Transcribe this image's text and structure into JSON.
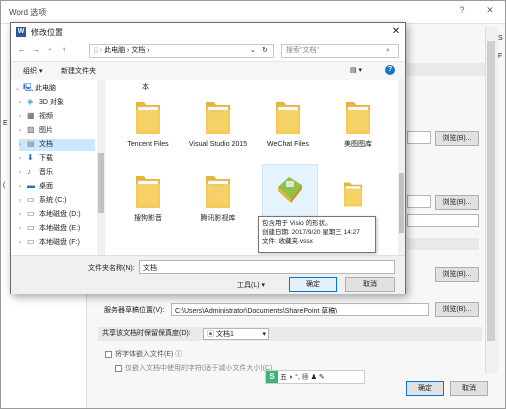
{
  "options_window": {
    "title": "Word 选项",
    "help": "?",
    "close": "✕",
    "browse_label": "浏览(B)...",
    "sp_label": "服务器草稿位置(V):",
    "sp_path": "C:\\Users\\Administrator\\Documents\\SharePoint 草稿\\",
    "fidelity_label": "共享该文档时保留保真度(D):",
    "fidelity_doc": "文档1",
    "embed_fonts": "将字体嵌入文件(E)",
    "embed_only_used": "仅嵌入文档中使用的字符(适于减小文件大小)(C)",
    "ok": "确定",
    "cancel": "取消",
    "side_letters": [
      "E",
      "(",
      "S",
      "F"
    ]
  },
  "dialog": {
    "title": "修改位置",
    "breadcrumb": [
      "此电脑",
      "文档"
    ],
    "search_placeholder": "搜索\"文档\"",
    "toolbar": {
      "organize": "组织 ▾",
      "new_folder": "新建文件夹",
      "view": "▤ ▾",
      "help": "?"
    },
    "tree": [
      {
        "label": "此电脑",
        "icon": "pc-icon",
        "expanded": true,
        "indent": 0
      },
      {
        "label": "3D 对象",
        "icon": "3d-objects-icon",
        "indent": 1
      },
      {
        "label": "视频",
        "icon": "video-icon",
        "indent": 1
      },
      {
        "label": "图片",
        "icon": "picture-icon",
        "indent": 1
      },
      {
        "label": "文档",
        "icon": "document-icon",
        "indent": 1,
        "selected": true
      },
      {
        "label": "下载",
        "icon": "download-icon",
        "indent": 1
      },
      {
        "label": "音乐",
        "icon": "music-icon",
        "indent": 1
      },
      {
        "label": "桌面",
        "icon": "desktop-icon",
        "indent": 1
      },
      {
        "label": "系统 (C:)",
        "icon": "drive-icon",
        "indent": 1
      },
      {
        "label": "本地磁盘 (D:)",
        "icon": "drive-icon",
        "indent": 1
      },
      {
        "label": "本地磁盘 (E:)",
        "icon": "drive-icon",
        "indent": 1
      },
      {
        "label": "本地磁盘 (F:)",
        "icon": "drive-icon",
        "indent": 1
      }
    ],
    "top_partial_label": "本",
    "files_row1": [
      "Tencent Files",
      "Visual Studio 2015",
      "WeChat Files",
      "美图图库"
    ],
    "files_row2": [
      "搜狗影音",
      "腾讯影视库",
      "",
      ""
    ],
    "tooltip": [
      "包含用于 Visio 的形状。",
      "创建日期: 2017/9/20 星期三 14:27",
      "文件: 收藏夹.vssx"
    ],
    "folder_name_label": "文件夹名称(N):",
    "folder_name_value": "文档",
    "tools": "工具(L)",
    "ok": "确定",
    "cancel": "取消"
  },
  "ime_bar": {
    "text": "五 ◗ °, ▦ ♟ ✎"
  },
  "colors": {
    "folder": "#f5c84b",
    "accent": "#0078d7",
    "selected": "#cce8ff"
  }
}
